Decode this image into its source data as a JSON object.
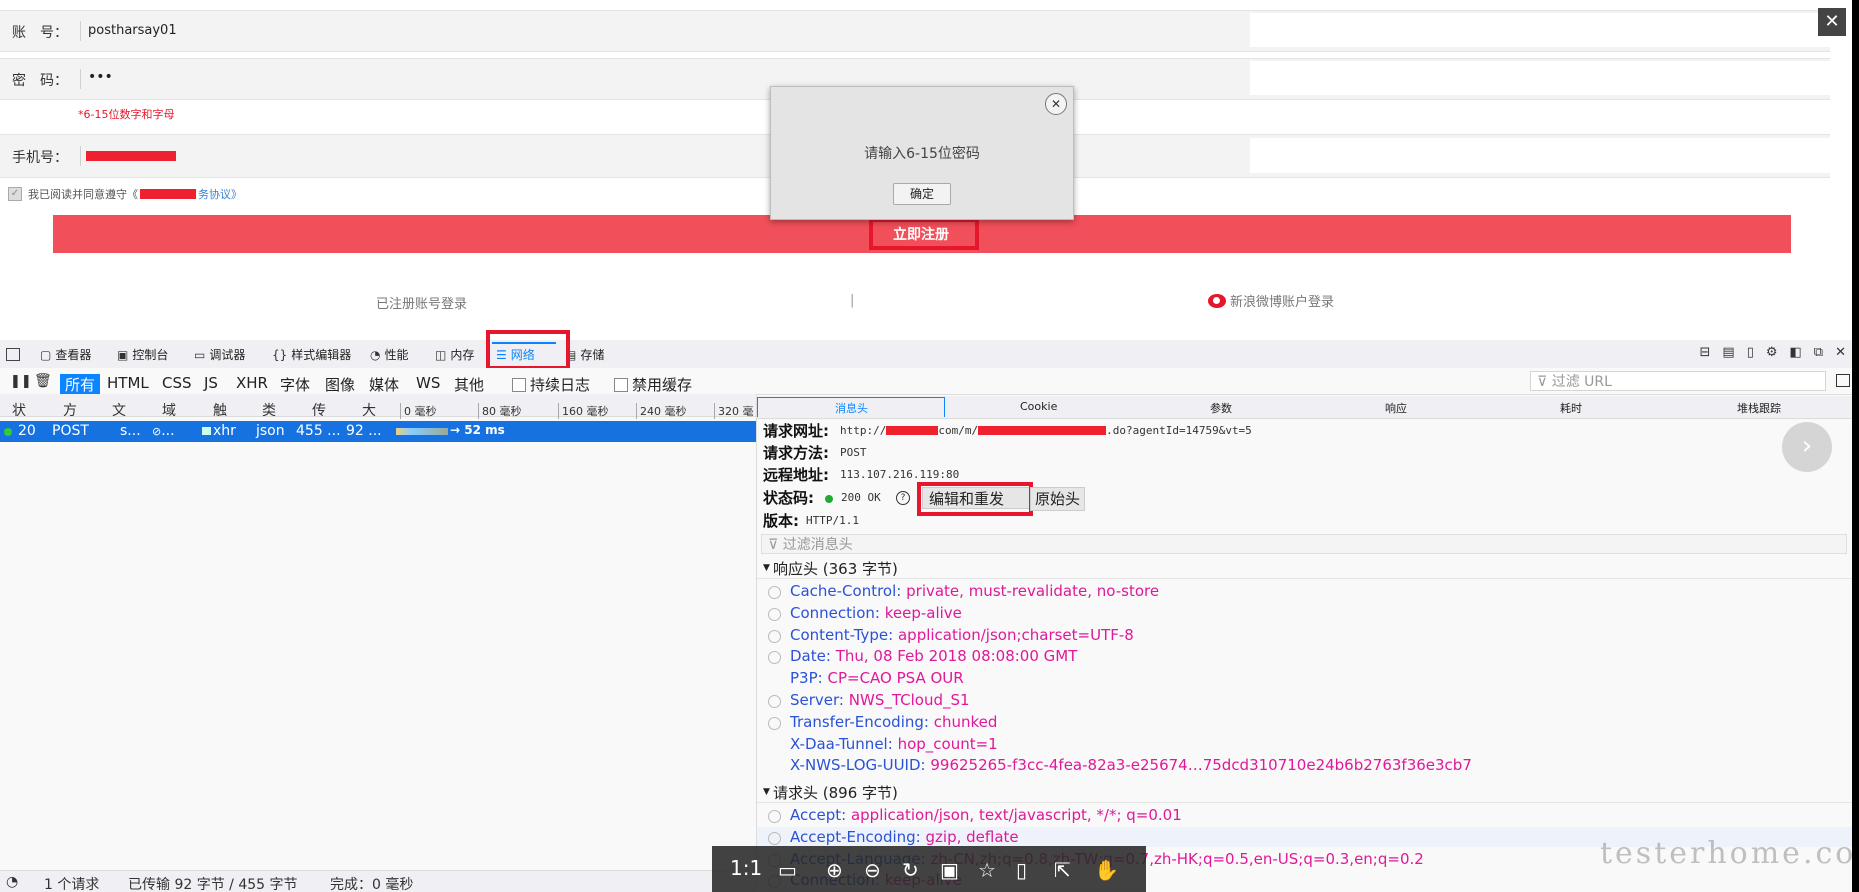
{
  "form": {
    "account_label": "账　号：",
    "account_value": "postharsay01",
    "password_label": "密　码：",
    "password_value": "•••",
    "password_hint": "*6-15位数字和字母",
    "phone_label": "手机号：",
    "agree_prefix": "我已阅读并同意遵守《",
    "agree_suffix": "务协议》",
    "register_button": "立即注册",
    "login_registered": "已注册账号登录",
    "divider": "|",
    "weibo_login": "新浪微博账户登录"
  },
  "dialog": {
    "message": "请输入6-15位密码",
    "confirm": "确定",
    "close": "✕"
  },
  "window_close": "✕",
  "devtools": {
    "tabs": [
      {
        "label": "查看器",
        "icon": "inspector-icon",
        "glyph": "▢"
      },
      {
        "label": "控制台",
        "icon": "console-icon",
        "glyph": "▣"
      },
      {
        "label": "调试器",
        "icon": "debugger-icon",
        "glyph": "▭"
      },
      {
        "label": "样式编辑器",
        "icon": "style-editor-icon",
        "glyph": "{}"
      },
      {
        "label": "性能",
        "icon": "performance-icon",
        "glyph": "◔"
      },
      {
        "label": "内存",
        "icon": "memory-icon",
        "glyph": "◫"
      },
      {
        "label": "网络",
        "icon": "network-icon",
        "glyph": "☰"
      },
      {
        "label": "存储",
        "icon": "storage-icon",
        "glyph": "▤"
      }
    ],
    "filters": [
      "所有",
      "HTML",
      "CSS",
      "JS",
      "XHR",
      "字体",
      "图像",
      "媒体",
      "WS",
      "其他"
    ],
    "persist_logs": "持续日志",
    "disable_cache": "禁用缓存",
    "filter_url_placeholder": "过滤 URL",
    "columns": [
      "状",
      "方",
      "文",
      "域",
      "触",
      "类",
      "传",
      "大"
    ],
    "timeline_ticks": [
      "0 毫秒",
      "80 毫秒",
      "160 毫秒",
      "240 毫秒",
      "320 毫"
    ],
    "request_row": {
      "status": "20",
      "method": "POST",
      "file": "s...",
      "domain": "...",
      "cause": "xhr",
      "type": "json",
      "transferred": "455 ...",
      "size": "92 ...",
      "time": "→ 52 ms"
    },
    "detail_tabs": [
      "消息头",
      "Cookie",
      "参数",
      "响应",
      "耗时",
      "堆栈跟踪"
    ],
    "request_url_label": "请求网址:",
    "request_url_parts": [
      "http://",
      "com/m/",
      ".do?agentId=14759&vt=5"
    ],
    "request_method_label": "请求方法:",
    "request_method": "POST",
    "remote_address_label": "远程地址:",
    "remote_address": "113.107.216.119:80",
    "status_code_label": "状态码:",
    "status_code": "200 OK",
    "edit_resend": "编辑和重发",
    "raw_headers": "原始头",
    "version_label": "版本:",
    "version": "HTTP/1.1",
    "filter_headers_placeholder": "过滤消息头",
    "response_headers_title": "响应头 (363 字节)",
    "response_headers": [
      {
        "k": "Cache-Control:",
        "v": "private, must-revalidate, no-store"
      },
      {
        "k": "Connection:",
        "v": "keep-alive"
      },
      {
        "k": "Content-Type:",
        "v": "application/json;charset=UTF-8"
      },
      {
        "k": "Date:",
        "v": "Thu, 08 Feb 2018 08:08:00 GMT"
      },
      {
        "k": "P3P:",
        "v": "CP=CAO PSA OUR"
      },
      {
        "k": "Server:",
        "v": "NWS_TCloud_S1"
      },
      {
        "k": "Transfer-Encoding:",
        "v": "chunked"
      },
      {
        "k": "X-Daa-Tunnel:",
        "v": "hop_count=1"
      },
      {
        "k": "X-NWS-LOG-UUID:",
        "v": "99625265-f3cc-4fea-82a3-e25674…75dcd310710e24b6b2763f36e3cb7"
      }
    ],
    "request_headers_title": "请求头 (896 字节)",
    "request_headers": [
      {
        "k": "Accept:",
        "v": "application/json, text/javascript, */*; q=0.01"
      },
      {
        "k": "Accept-Encoding:",
        "v": "gzip, deflate"
      },
      {
        "k": "Accept-Language:",
        "v": "zh-CN,zh;q=0.8,zh-TW;q=0.7,zh-HK;q=0.5,en-US;q=0.3,en;q=0.2"
      },
      {
        "k": "Connection:",
        "v": "keep-alive"
      }
    ],
    "status_bar": {
      "requests": "1 个请求",
      "transferred": "已传输 92 字节 / 455 字节",
      "finish": "完成：0 毫秒"
    }
  },
  "viewer_bar": {
    "zoom_label": "1:1"
  },
  "watermark": "testerhome.com"
}
